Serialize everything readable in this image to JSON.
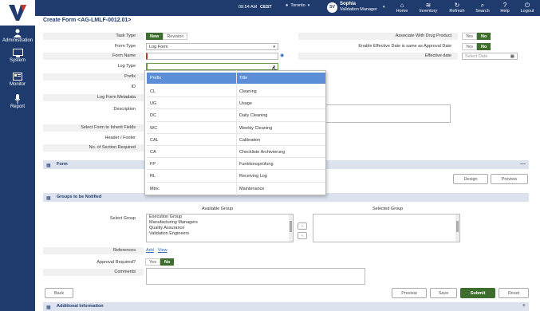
{
  "header": {
    "time": "09:54 AM",
    "timezone": "CEST",
    "location": "Toronto",
    "user_initials": "SV",
    "user_name": "Sophia",
    "user_role": "Validation Manager",
    "nav": [
      {
        "label": "Home",
        "icon": "home-icon"
      },
      {
        "label": "Inventory",
        "icon": "inventory-icon"
      },
      {
        "label": "Refresh",
        "icon": "refresh-icon"
      },
      {
        "label": "Search",
        "icon": "search-icon"
      },
      {
        "label": "Help",
        "icon": "help-icon"
      },
      {
        "label": "Logout",
        "icon": "logout-icon"
      }
    ]
  },
  "sidebar": {
    "items": [
      {
        "label": "Administration",
        "icon": "user-admin-icon"
      },
      {
        "label": "System",
        "icon": "monitor-icon"
      },
      {
        "label": "Monitor",
        "icon": "dashboard-icon"
      },
      {
        "label": "Report",
        "icon": "microphone-icon"
      }
    ]
  },
  "page": {
    "title": "Create Form  <AG-LMLF-0012.01>"
  },
  "form": {
    "task_type_label": "Task Type",
    "task_type_new": "New",
    "task_type_revision": "Revision",
    "form_type_label": "Form Type",
    "form_type_value": "Log Form",
    "form_name_label": "Form Name",
    "log_type_label": "Log Type",
    "prefix_label": "Prefix",
    "id_label": "ID",
    "log_form_metadata_label": "Log Form Metadata",
    "description_label": "Description",
    "inherit_label": "Select Form to Inherit Fields",
    "header_footer_label": "Header / Footer",
    "sections_label": "No. of Section Required",
    "drug_product_label": "Associate With Drug Product",
    "drug_yes": "Yes",
    "drug_no": "No",
    "effective_same_label": "Enable Effective Date is same as Approval Date",
    "eff_yes": "Yes",
    "eff_no": "No",
    "effective_date_label": "Effective date",
    "effective_date_placeholder": "Select Date"
  },
  "dropdown": {
    "col_prefix": "Prefix",
    "col_title": "Title",
    "rows": [
      {
        "prefix": "CL",
        "title": "Cleaning"
      },
      {
        "prefix": "UG",
        "title": "Usage"
      },
      {
        "prefix": "DC",
        "title": "Daily Cleaning"
      },
      {
        "prefix": "WC",
        "title": "Weekly Cleaning"
      },
      {
        "prefix": "CAL",
        "title": "Calibration"
      },
      {
        "prefix": "CA",
        "title": "Checkliste Archivierung"
      },
      {
        "prefix": "FP",
        "title": "Funktionsprüfung"
      },
      {
        "prefix": "RL",
        "title": "Receiving Log"
      },
      {
        "prefix": "Mtnc",
        "title": "Maintenance"
      }
    ]
  },
  "form_section": {
    "title": "Form",
    "design_label": "Design",
    "preview_label": "Preview"
  },
  "groups_section": {
    "title": "Groups to be Notified",
    "select_group_label": "Select Group",
    "available_label": "Available Group",
    "selected_label": "Selected Group",
    "available": [
      "Execution Group",
      "Manufacturing Managers",
      "Quality Assurance",
      "Validation Engineers"
    ],
    "references_label": "References",
    "add_link": "Add",
    "view_link": "View",
    "approval_label": "Approval Required?",
    "approval_yes": "Yes",
    "approval_no": "No",
    "comments_label": "Comments"
  },
  "actions": {
    "back": "Back",
    "preview": "Preview",
    "save": "Save",
    "submit": "Submit",
    "reset": "Reset"
  },
  "additional_section": {
    "title": "Additional Information"
  },
  "colors": {
    "navy": "#1f3b6e",
    "green": "#3e6e2e",
    "header_blue": "#5b8ed6"
  }
}
